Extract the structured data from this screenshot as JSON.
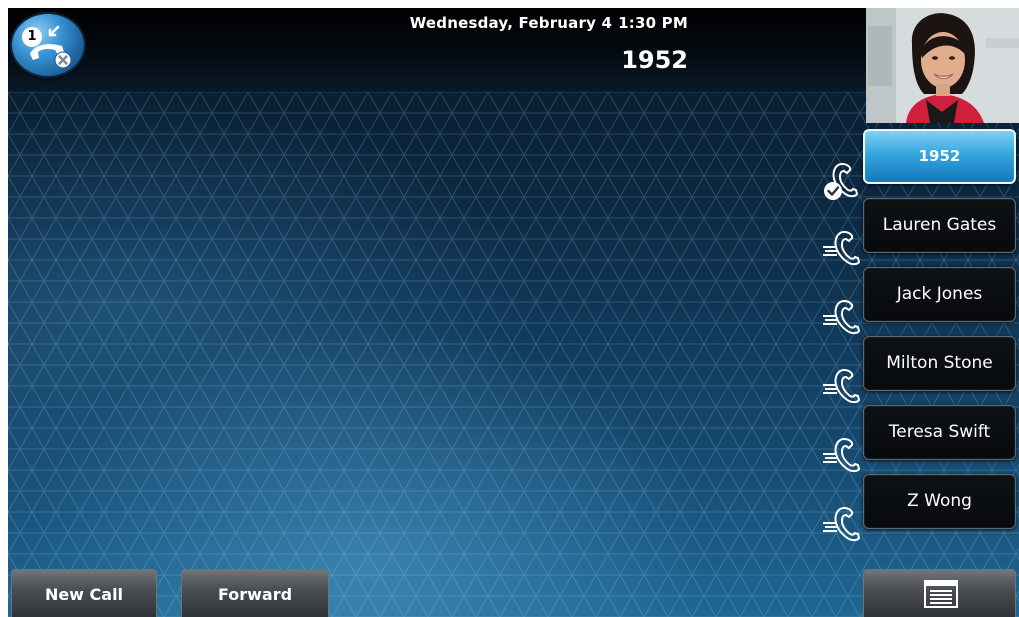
{
  "header": {
    "date": "Wednesday, February 4",
    "time": "1:30 PM",
    "extension": "1952",
    "line_status_badge": "1",
    "line_status_icon": "phone-missed-call-icon"
  },
  "video": {
    "icon": "self-view-video"
  },
  "line_keys": [
    {
      "label": "1952",
      "state": "registered",
      "icon": "phone-check-icon"
    },
    {
      "label": "Lauren Gates",
      "state": "idle",
      "icon": "phone-speed-dial-icon"
    },
    {
      "label": "Jack Jones",
      "state": "idle",
      "icon": "phone-speed-dial-icon"
    },
    {
      "label": "Milton Stone",
      "state": "idle",
      "icon": "phone-speed-dial-icon"
    },
    {
      "label": "Teresa Swift",
      "state": "idle",
      "icon": "phone-speed-dial-icon"
    },
    {
      "label": "Z Wong",
      "state": "idle",
      "icon": "phone-speed-dial-icon"
    }
  ],
  "softkeys": {
    "new_call": "New Call",
    "forward": "Forward",
    "menu_icon": "menu-icon"
  },
  "colors": {
    "active_key": "#35a6de",
    "background": "#15466b"
  }
}
